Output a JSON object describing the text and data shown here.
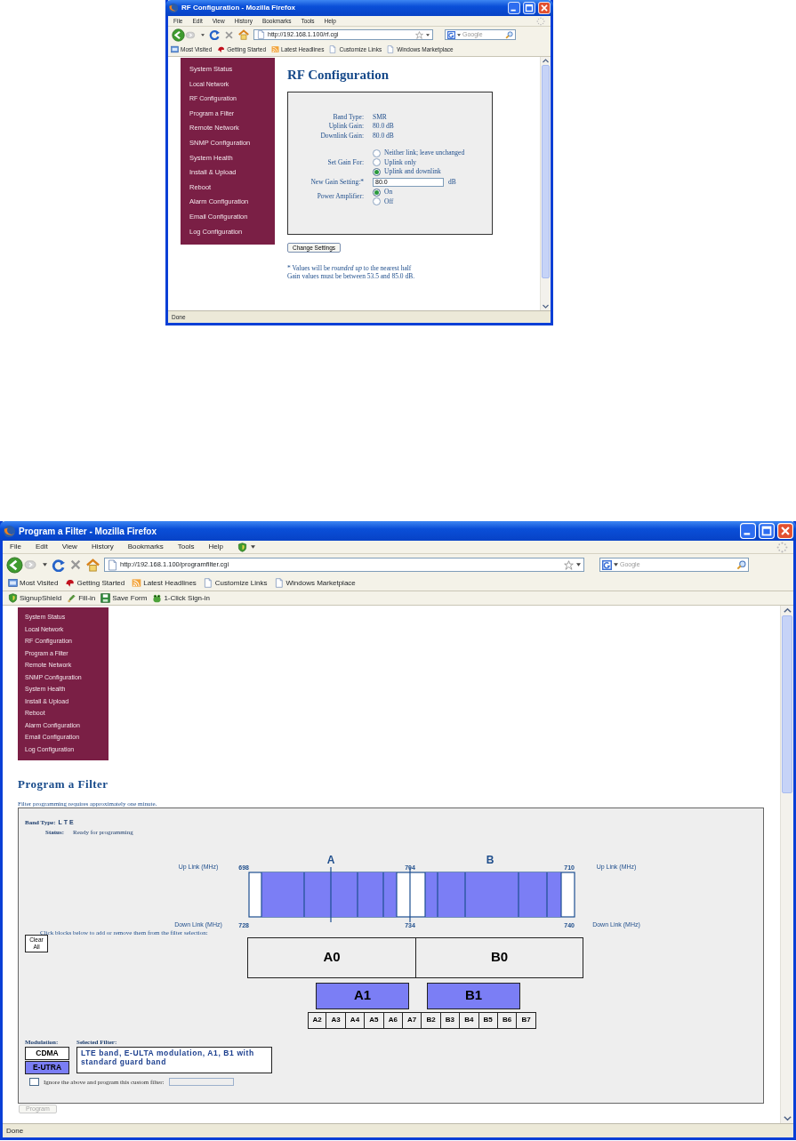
{
  "windows": [
    {
      "kind": "rf_config",
      "title": "RF Configuration - Mozilla Firefox",
      "menu": [
        "File",
        "Edit",
        "View",
        "History",
        "Bookmarks",
        "Tools",
        "Help"
      ],
      "address": "http://192.168.1.100/rf.cgi",
      "search_placeholder": "Google",
      "bookmarks": [
        "Most Visited",
        "Getting Started",
        "Latest Headlines",
        "Customize Links",
        "Windows Marketplace"
      ],
      "sidebar": [
        {
          "label": "System Status",
          "kind": "main"
        },
        {
          "label": "Local Network",
          "kind": "sub"
        },
        {
          "label": "RF Configuration",
          "kind": "sub"
        },
        {
          "label": "Program a Filter",
          "kind": "sub"
        },
        {
          "label": "Remote Network",
          "kind": "main"
        },
        {
          "label": "SNMP Configuration",
          "kind": "main"
        },
        {
          "label": "System Health",
          "kind": "main"
        },
        {
          "label": "Install & Upload",
          "kind": "main"
        },
        {
          "label": "Reboot",
          "kind": "main"
        },
        {
          "label": "Alarm Configuration",
          "kind": "main"
        },
        {
          "label": "Email Configuration",
          "kind": "main"
        },
        {
          "label": "Log Configuration",
          "kind": "main"
        }
      ],
      "page": {
        "heading": "RF Configuration",
        "fields": [
          {
            "label": "Band Type:",
            "value": "SMR"
          },
          {
            "label": "Uplink Gain:",
            "value": "80.0 dB"
          },
          {
            "label": "Downlink Gain:",
            "value": "80.0 dB"
          }
        ],
        "gain_for": {
          "label": "Set Gain For:",
          "options": [
            {
              "label": "Neither link; leave unchanged",
              "selected": false
            },
            {
              "label": "Uplink only",
              "selected": false
            },
            {
              "label": "Uplink and downlink",
              "selected": true
            }
          ]
        },
        "new_gain": {
          "label": "New Gain Setting:*",
          "value": "80.0",
          "unit": "dB"
        },
        "amplifier": {
          "label": "Power Amplifier:",
          "options": [
            {
              "label": "On",
              "selected": true
            },
            {
              "label": "Off",
              "selected": false
            }
          ]
        },
        "button": "Change Settings",
        "notes": [
          "* Values will be *rounded up* to the nearest half",
          "Gain values must be between 53.5 and 85.0 dB."
        ]
      },
      "status": "Done"
    },
    {
      "kind": "program_filter",
      "title": "Program a Filter - Mozilla Firefox",
      "menu": [
        "File",
        "Edit",
        "View",
        "History",
        "Bookmarks",
        "Tools",
        "Help"
      ],
      "address": "http://192.168.1.100/programfilter.cgi",
      "search_placeholder": "Google",
      "bookmarks": [
        "Most Visited",
        "Getting Started",
        "Latest Headlines",
        "Customize Links",
        "Windows Marketplace"
      ],
      "extra_toolbar": [
        "SignupShield",
        "Fill-in",
        "Save Form",
        "1-Click Sign-in"
      ],
      "sidebar": [
        {
          "label": "System Status",
          "kind": "main"
        },
        {
          "label": "Local Network",
          "kind": "sub"
        },
        {
          "label": "RF Configuration",
          "kind": "main"
        },
        {
          "label": "Program a Filter",
          "kind": "sub"
        },
        {
          "label": "Remote Network",
          "kind": "main"
        },
        {
          "label": "SNMP Configuration",
          "kind": "main"
        },
        {
          "label": "System Health",
          "kind": "main"
        },
        {
          "label": "Install & Upload",
          "kind": "main"
        },
        {
          "label": "Reboot",
          "kind": "main"
        },
        {
          "label": "Alarm Configuration",
          "kind": "main"
        },
        {
          "label": "Email Configuration",
          "kind": "main"
        },
        {
          "label": "Log Configuration",
          "kind": "main"
        }
      ],
      "page": {
        "heading": "Program a Filter",
        "note": "Filter programming requires approximately one minute.",
        "band_type": {
          "label": "Band Type:",
          "value": "L T E"
        },
        "status": {
          "label": "Status:",
          "value": "Ready for programming"
        },
        "band_plan": {
          "block_letters": [
            "A",
            "B"
          ],
          "uplink_labels": [
            "Up Link (MHz)",
            "Up Link (MHz)"
          ],
          "downlink_labels": [
            "Down Link (MHz)",
            "Down Link (MHz)"
          ],
          "uplink_ticks": [
            "698",
            "704",
            "710"
          ],
          "downlink_ticks": [
            "728",
            "734",
            "740"
          ]
        },
        "instruction": "Click blocks below to add or remove them from the filter selection:",
        "clear_button": "Clear All",
        "blocks": [
          [
            {
              "label": "A0",
              "selected": false
            },
            {
              "label": "B0",
              "selected": false
            }
          ],
          [
            {
              "label": "A1",
              "selected": true
            },
            {
              "label": "B1",
              "selected": true
            }
          ],
          [
            {
              "label": "A2",
              "selected": false
            },
            {
              "label": "A3",
              "selected": false
            },
            {
              "label": "A4",
              "selected": false
            },
            {
              "label": "A5",
              "selected": false
            },
            {
              "label": "A6",
              "selected": false
            },
            {
              "label": "A7",
              "selected": false
            },
            {
              "label": "B2",
              "selected": false
            },
            {
              "label": "B3",
              "selected": false
            },
            {
              "label": "B4",
              "selected": false
            },
            {
              "label": "B5",
              "selected": false
            },
            {
              "label": "B6",
              "selected": false
            },
            {
              "label": "B7",
              "selected": false
            }
          ]
        ],
        "modulation": {
          "label": "Modulation:",
          "options": [
            {
              "label": "CDMA",
              "selected": false
            },
            {
              "label": "E-UTRA",
              "selected": true
            }
          ]
        },
        "selected_filter": {
          "label": "Selected Filter:",
          "text": "LTE band, E-ULTA modulation, A1, B1 with standard guard band"
        },
        "custom": {
          "label": "Ignore the above and program this custom filter:",
          "checked": false
        },
        "program_button": {
          "label": "Program",
          "disabled": true
        }
      },
      "status": "Done"
    }
  ]
}
